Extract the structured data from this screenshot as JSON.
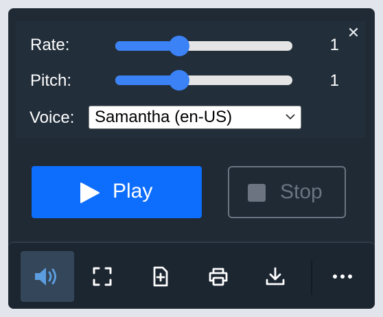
{
  "settings": {
    "rate": {
      "label": "Rate:",
      "value": "1",
      "level": 0.36
    },
    "pitch": {
      "label": "Pitch:",
      "value": "1",
      "level": 0.36
    },
    "voice": {
      "label": "Voice:",
      "selected": "Samantha (en-US)"
    },
    "close_icon": "close-icon"
  },
  "controls": {
    "play": {
      "label": "Play",
      "icon": "play-icon"
    },
    "stop": {
      "label": "Stop",
      "icon": "stop-icon",
      "disabled": true
    }
  },
  "toolbar": {
    "items": [
      {
        "name": "speaker-icon",
        "active": true
      },
      {
        "name": "fullscreen-icon"
      },
      {
        "name": "add-document-icon"
      },
      {
        "name": "print-icon"
      },
      {
        "name": "download-icon"
      },
      {
        "name": "more-icon"
      }
    ]
  },
  "colors": {
    "accent": "#0d6efd",
    "slider": "#3b82f6",
    "background": "#1f2a35",
    "disabled": "#6b7480"
  }
}
